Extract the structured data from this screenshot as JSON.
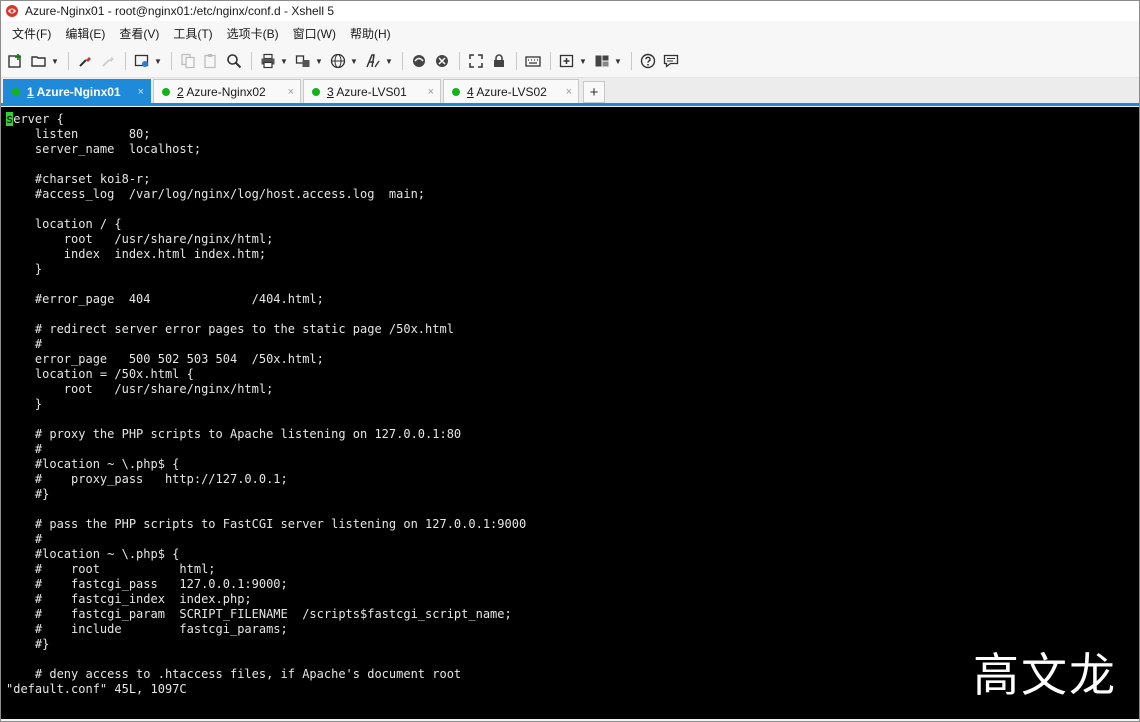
{
  "window": {
    "title": "Azure-Nginx01 - root@nginx01:/etc/nginx/conf.d - Xshell 5"
  },
  "menu": {
    "items": [
      "文件(F)",
      "编辑(E)",
      "查看(V)",
      "工具(T)",
      "选项卡(B)",
      "窗口(W)",
      "帮助(H)"
    ]
  },
  "toolbar": {
    "icons": [
      "new-session-icon",
      "open-folder-icon",
      "disconnect-icon",
      "reconnect-icon",
      "properties-icon",
      "copy-icon",
      "paste-icon",
      "find-icon",
      "print-icon",
      "transfer-icon",
      "globe-icon",
      "font-icon",
      "xftp-icon",
      "xmanager-icon",
      "fullscreen-icon",
      "lock-icon",
      "keyboard-icon",
      "new-tab-icon",
      "layout-icon",
      "help-icon",
      "chat-icon"
    ]
  },
  "tabs": [
    {
      "num": "1",
      "label": " Azure-Nginx01",
      "active": true
    },
    {
      "num": "2",
      "label": " Azure-Nginx02",
      "active": false
    },
    {
      "num": "3",
      "label": " Azure-LVS01",
      "active": false
    },
    {
      "num": "4",
      "label": " Azure-LVS02",
      "active": false
    }
  ],
  "tab_close": "×",
  "tab_add": "+",
  "terminal": {
    "cursor_char": "s",
    "first_line_rest": "erver {",
    "lines": [
      "    listen       80;",
      "    server_name  localhost;",
      "",
      "    #charset koi8-r;",
      "    #access_log  /var/log/nginx/log/host.access.log  main;",
      "",
      "    location / {",
      "        root   /usr/share/nginx/html;",
      "        index  index.html index.htm;",
      "    }",
      "",
      "    #error_page  404              /404.html;",
      "",
      "    # redirect server error pages to the static page /50x.html",
      "    #",
      "    error_page   500 502 503 504  /50x.html;",
      "    location = /50x.html {",
      "        root   /usr/share/nginx/html;",
      "    }",
      "",
      "    # proxy the PHP scripts to Apache listening on 127.0.0.1:80",
      "    #",
      "    #location ~ \\.php$ {",
      "    #    proxy_pass   http://127.0.0.1;",
      "    #}",
      "",
      "    # pass the PHP scripts to FastCGI server listening on 127.0.0.1:9000",
      "    #",
      "    #location ~ \\.php$ {",
      "    #    root           html;",
      "    #    fastcgi_pass   127.0.0.1:9000;",
      "    #    fastcgi_index  index.php;",
      "    #    fastcgi_param  SCRIPT_FILENAME  /scripts$fastcgi_script_name;",
      "    #    include        fastcgi_params;",
      "    #}",
      "",
      "    # deny access to .htaccess files, if Apache's document root"
    ],
    "status": "\"default.conf\" 45L, 1097C"
  },
  "watermark": "高文龙",
  "colors": {
    "accent": "#1f8ad8",
    "terminal_bg": "#000000",
    "terminal_fg": "#e6e6e6",
    "cursor": "#2fd12f",
    "connected_dot": "#16b21c"
  }
}
